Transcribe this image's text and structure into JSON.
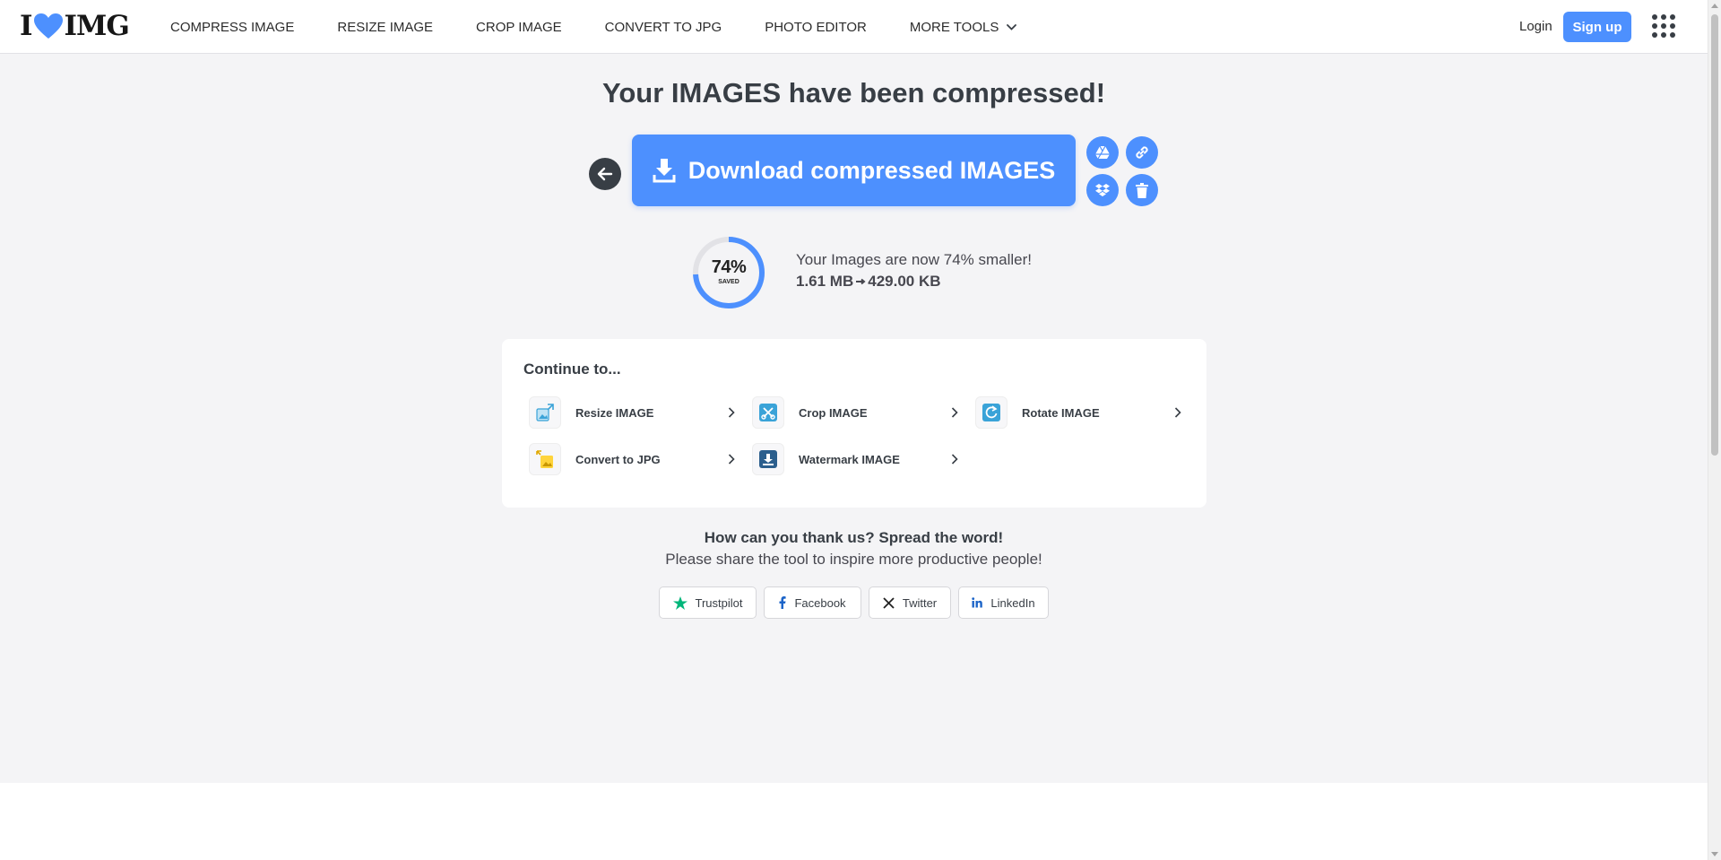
{
  "header": {
    "logo_left": "I",
    "logo_right": "IMG",
    "nav": [
      {
        "label": "COMPRESS IMAGE"
      },
      {
        "label": "RESIZE IMAGE"
      },
      {
        "label": "CROP IMAGE"
      },
      {
        "label": "CONVERT TO JPG"
      },
      {
        "label": "PHOTO EDITOR"
      },
      {
        "label": "MORE TOOLS"
      }
    ],
    "login_label": "Login",
    "signup_label": "Sign up"
  },
  "main": {
    "title": "Your IMAGES have been compressed!",
    "download_label": "Download compressed IMAGES",
    "side_buttons": [
      "google-drive-icon",
      "link-icon",
      "dropbox-icon",
      "trash-icon"
    ]
  },
  "stats": {
    "saved_percent": 74,
    "percent_label": "74%",
    "saved_label": "SAVED",
    "smaller_text": "Your Images are now 74% smaller!",
    "original_size": "1.61 MB",
    "new_size": "429.00 KB"
  },
  "continue": {
    "title": "Continue to...",
    "tools": [
      {
        "label": "Resize IMAGE",
        "icon": "resize-icon"
      },
      {
        "label": "Crop IMAGE",
        "icon": "crop-icon"
      },
      {
        "label": "Rotate IMAGE",
        "icon": "rotate-icon"
      },
      {
        "label": "Convert to JPG",
        "icon": "convert-jpg-icon"
      },
      {
        "label": "Watermark IMAGE",
        "icon": "watermark-icon"
      }
    ]
  },
  "share": {
    "title": "How can you thank us? Spread the word!",
    "subtitle": "Please share the tool to inspire more productive people!",
    "buttons": [
      {
        "label": "Trustpilot",
        "icon": "star-icon"
      },
      {
        "label": "Facebook",
        "icon": "facebook-icon"
      },
      {
        "label": "Twitter",
        "icon": "x-icon"
      },
      {
        "label": "LinkedIn",
        "icon": "linkedin-icon"
      }
    ]
  },
  "colors": {
    "accent": "#4d90fe",
    "logo_heart": "#4d90fe",
    "text": "#383e45",
    "background": "#f4f4f6"
  }
}
